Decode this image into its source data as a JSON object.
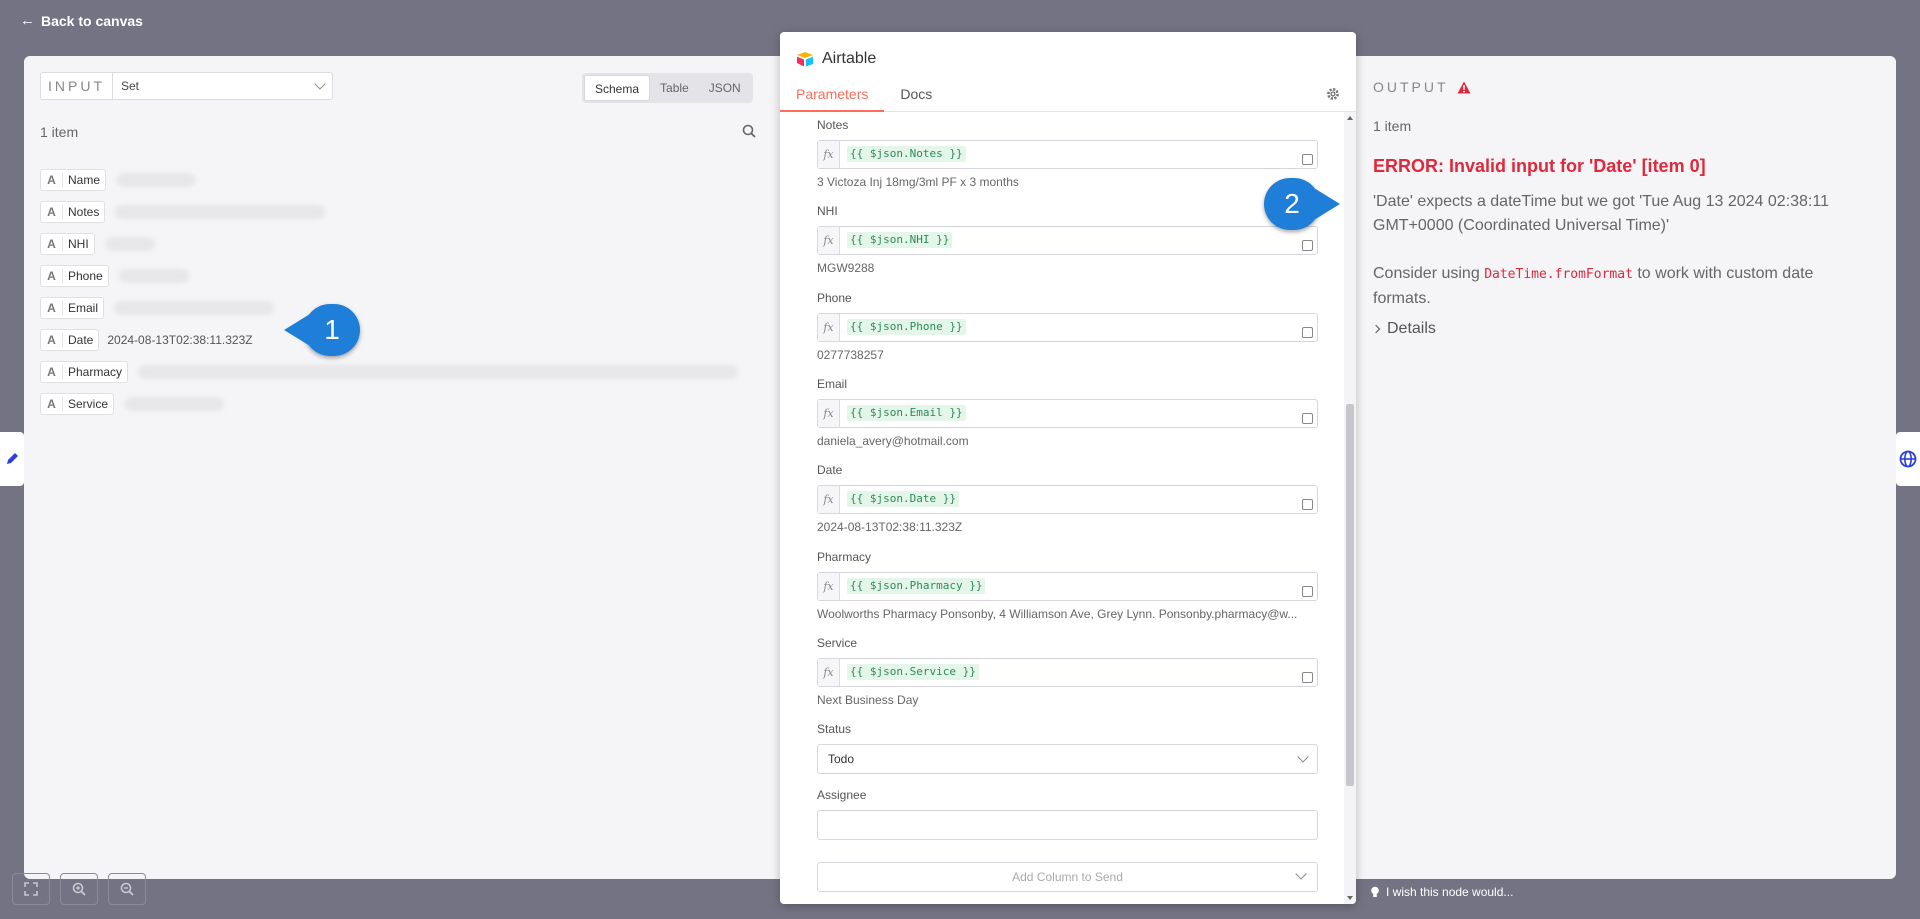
{
  "back_link": "Back to canvas",
  "input": {
    "label": "INPUT",
    "node": "Set",
    "views": [
      "Schema",
      "Table",
      "JSON"
    ],
    "active_view": "Schema",
    "item_count": "1 item",
    "fields": [
      {
        "type": "A",
        "name": "Name",
        "value": ""
      },
      {
        "type": "A",
        "name": "Notes",
        "value": ""
      },
      {
        "type": "A",
        "name": "NHI",
        "value": ""
      },
      {
        "type": "A",
        "name": "Phone",
        "value": ""
      },
      {
        "type": "A",
        "name": "Email",
        "value": ""
      },
      {
        "type": "A",
        "name": "Date",
        "value": "2024-08-13T02:38:11.323Z"
      },
      {
        "type": "A",
        "name": "Pharmacy",
        "value": ""
      },
      {
        "type": "A",
        "name": "Service",
        "value": ""
      }
    ]
  },
  "callouts": [
    "1",
    "2"
  ],
  "node_panel": {
    "title": "Airtable",
    "tabs": [
      "Parameters",
      "Docs"
    ],
    "params": [
      {
        "label": "Notes",
        "expr": "{{ $json.Notes }}",
        "preview": "3 Victoza Inj 18mg/3ml PF x 3 months"
      },
      {
        "label": "NHI",
        "expr": "{{ $json.NHI }}",
        "preview": "MGW9288"
      },
      {
        "label": "Phone",
        "expr": "{{ $json.Phone }}",
        "preview": "0277738257"
      },
      {
        "label": "Email",
        "expr": "{{ $json.Email }}",
        "preview": "daniela_avery@hotmail.com"
      },
      {
        "label": "Date",
        "expr": "{{ $json.Date }}",
        "preview": "2024-08-13T02:38:11.323Z"
      },
      {
        "label": "Pharmacy",
        "expr": "{{ $json.Pharmacy }}",
        "preview": "Woolworths Pharmacy Ponsonby, 4 Williamson Ave, Grey Lynn. Ponsonby.pharmacy@w..."
      },
      {
        "label": "Service",
        "expr": "{{ $json.Service }}",
        "preview": "Next Business Day"
      }
    ],
    "status_label": "Status",
    "status_value": "Todo",
    "assignee_label": "Assignee",
    "assignee_value": "",
    "add_column": "Add Column to Send"
  },
  "output": {
    "label": "OUTPUT",
    "item_count": "1 item",
    "error_title": "ERROR: Invalid input for 'Date' [item 0]",
    "error_message": "'Date' expects a dateTime but we got 'Tue Aug 13 2024 02:38:11 GMT+0000 (Coordinated Universal Time)'",
    "hint_prefix": "Consider using",
    "hint_code": "DateTime.fromFormat",
    "hint_suffix": "to work with custom date formats.",
    "details": "Details"
  },
  "footer": {
    "wish": "I wish this node would..."
  },
  "colors": {
    "accent": "#ff6d5a",
    "error": "#e0283c",
    "callout": "#1f7fd8",
    "expr_green": "#2e8b57"
  }
}
